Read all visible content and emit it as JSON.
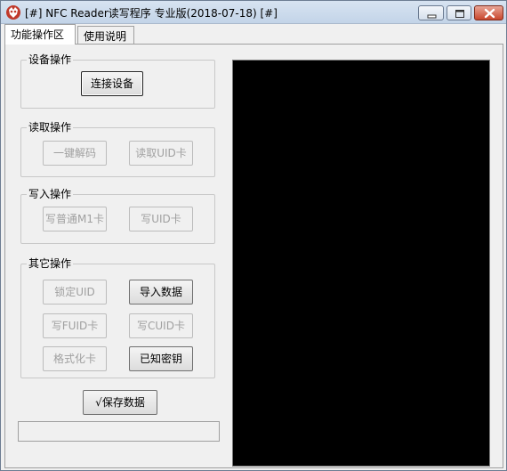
{
  "window": {
    "title": "[#] NFC Reader读写程序 专业版(2018-07-18) [#]",
    "icon": "nfc-app-icon",
    "controls": {
      "minimize": "minimize-icon",
      "maximize": "maximize-icon",
      "close": "close-icon"
    }
  },
  "tabs": [
    {
      "label": "功能操作区",
      "active": true
    },
    {
      "label": "使用说明",
      "active": false
    }
  ],
  "groups": {
    "device": {
      "label": "设备操作",
      "buttons": [
        {
          "label": "连接设备",
          "enabled": true
        }
      ]
    },
    "read": {
      "label": "读取操作",
      "buttons": [
        {
          "label": "一键解码",
          "enabled": false
        },
        {
          "label": "读取UID卡",
          "enabled": false
        }
      ]
    },
    "write": {
      "label": "写入操作",
      "buttons": [
        {
          "label": "写普通M1卡",
          "enabled": false
        },
        {
          "label": "写UID卡",
          "enabled": false
        }
      ]
    },
    "other": {
      "label": "其它操作",
      "buttons": [
        {
          "label": "锁定UID",
          "enabled": false
        },
        {
          "label": "导入数据",
          "enabled": true
        },
        {
          "label": "写FUID卡",
          "enabled": false
        },
        {
          "label": "写CUID卡",
          "enabled": false
        },
        {
          "label": "格式化卡",
          "enabled": false
        },
        {
          "label": "已知密钥",
          "enabled": true
        }
      ]
    }
  },
  "save_button": {
    "label": "√保存数据",
    "enabled": true
  },
  "status_text": "",
  "console_text": "",
  "colors": {
    "console_bg": "#000000",
    "window_bg": "#f0f0f0",
    "close_button": "#c9462c"
  }
}
